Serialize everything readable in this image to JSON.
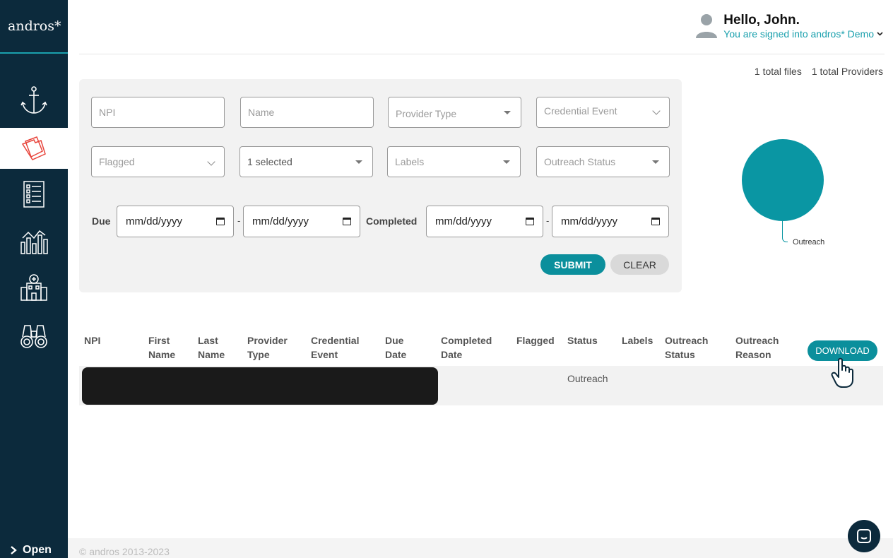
{
  "brand": {
    "logo": "andros*"
  },
  "sidebar": {
    "items": [
      {
        "icon": "anchor-icon"
      },
      {
        "icon": "folder-icon",
        "active": true
      },
      {
        "icon": "checklist-icon"
      },
      {
        "icon": "analytics-icon"
      },
      {
        "icon": "hospital-icon"
      },
      {
        "icon": "binoculars-icon"
      }
    ],
    "open_label": "Open"
  },
  "header": {
    "greeting": "Hello, John.",
    "signed_in": "You are signed into andros* Demo"
  },
  "summary": {
    "files": "1 total files",
    "providers": "1 total Providers"
  },
  "filters": {
    "npi_placeholder": "NPI",
    "name_placeholder": "Name",
    "provider_type": "Provider Type",
    "credential_event": "Credential Event",
    "flagged": "Flagged",
    "selected": "1 selected",
    "labels": "Labels",
    "outreach_status": "Outreach Status",
    "due_label": "Due",
    "completed_label": "Completed",
    "date_placeholder": "mm/dd/yyyy",
    "range_separator": "-",
    "submit": "SUBMIT",
    "clear": "CLEAR"
  },
  "chart_data": {
    "type": "pie",
    "categories": [
      "Outreach"
    ],
    "values": [
      1
    ]
  },
  "table": {
    "columns": [
      {
        "line1": "",
        "line2": "NPI"
      },
      {
        "line1": "First",
        "line2": "Name"
      },
      {
        "line1": "Last",
        "line2": "Name"
      },
      {
        "line1": "Provider",
        "line2": "Type"
      },
      {
        "line1": "Credential",
        "line2": "Event"
      },
      {
        "line1": "Due",
        "line2": "Date"
      },
      {
        "line1": "Completed",
        "line2": "Date"
      },
      {
        "line1": "",
        "line2": "Flagged"
      },
      {
        "line1": "",
        "line2": "Status"
      },
      {
        "line1": "",
        "line2": "Labels"
      },
      {
        "line1": "Outreach",
        "line2": "Status"
      },
      {
        "line1": "Outreach",
        "line2": "Reason"
      }
    ],
    "rows": [
      {
        "status": "Outreach"
      }
    ],
    "download": "DOWNLOAD"
  },
  "footer": {
    "copyright": "© andros 2013-2023"
  },
  "colors": {
    "accent": "#0b8f9c",
    "sidebar": "#0c2a3c"
  }
}
